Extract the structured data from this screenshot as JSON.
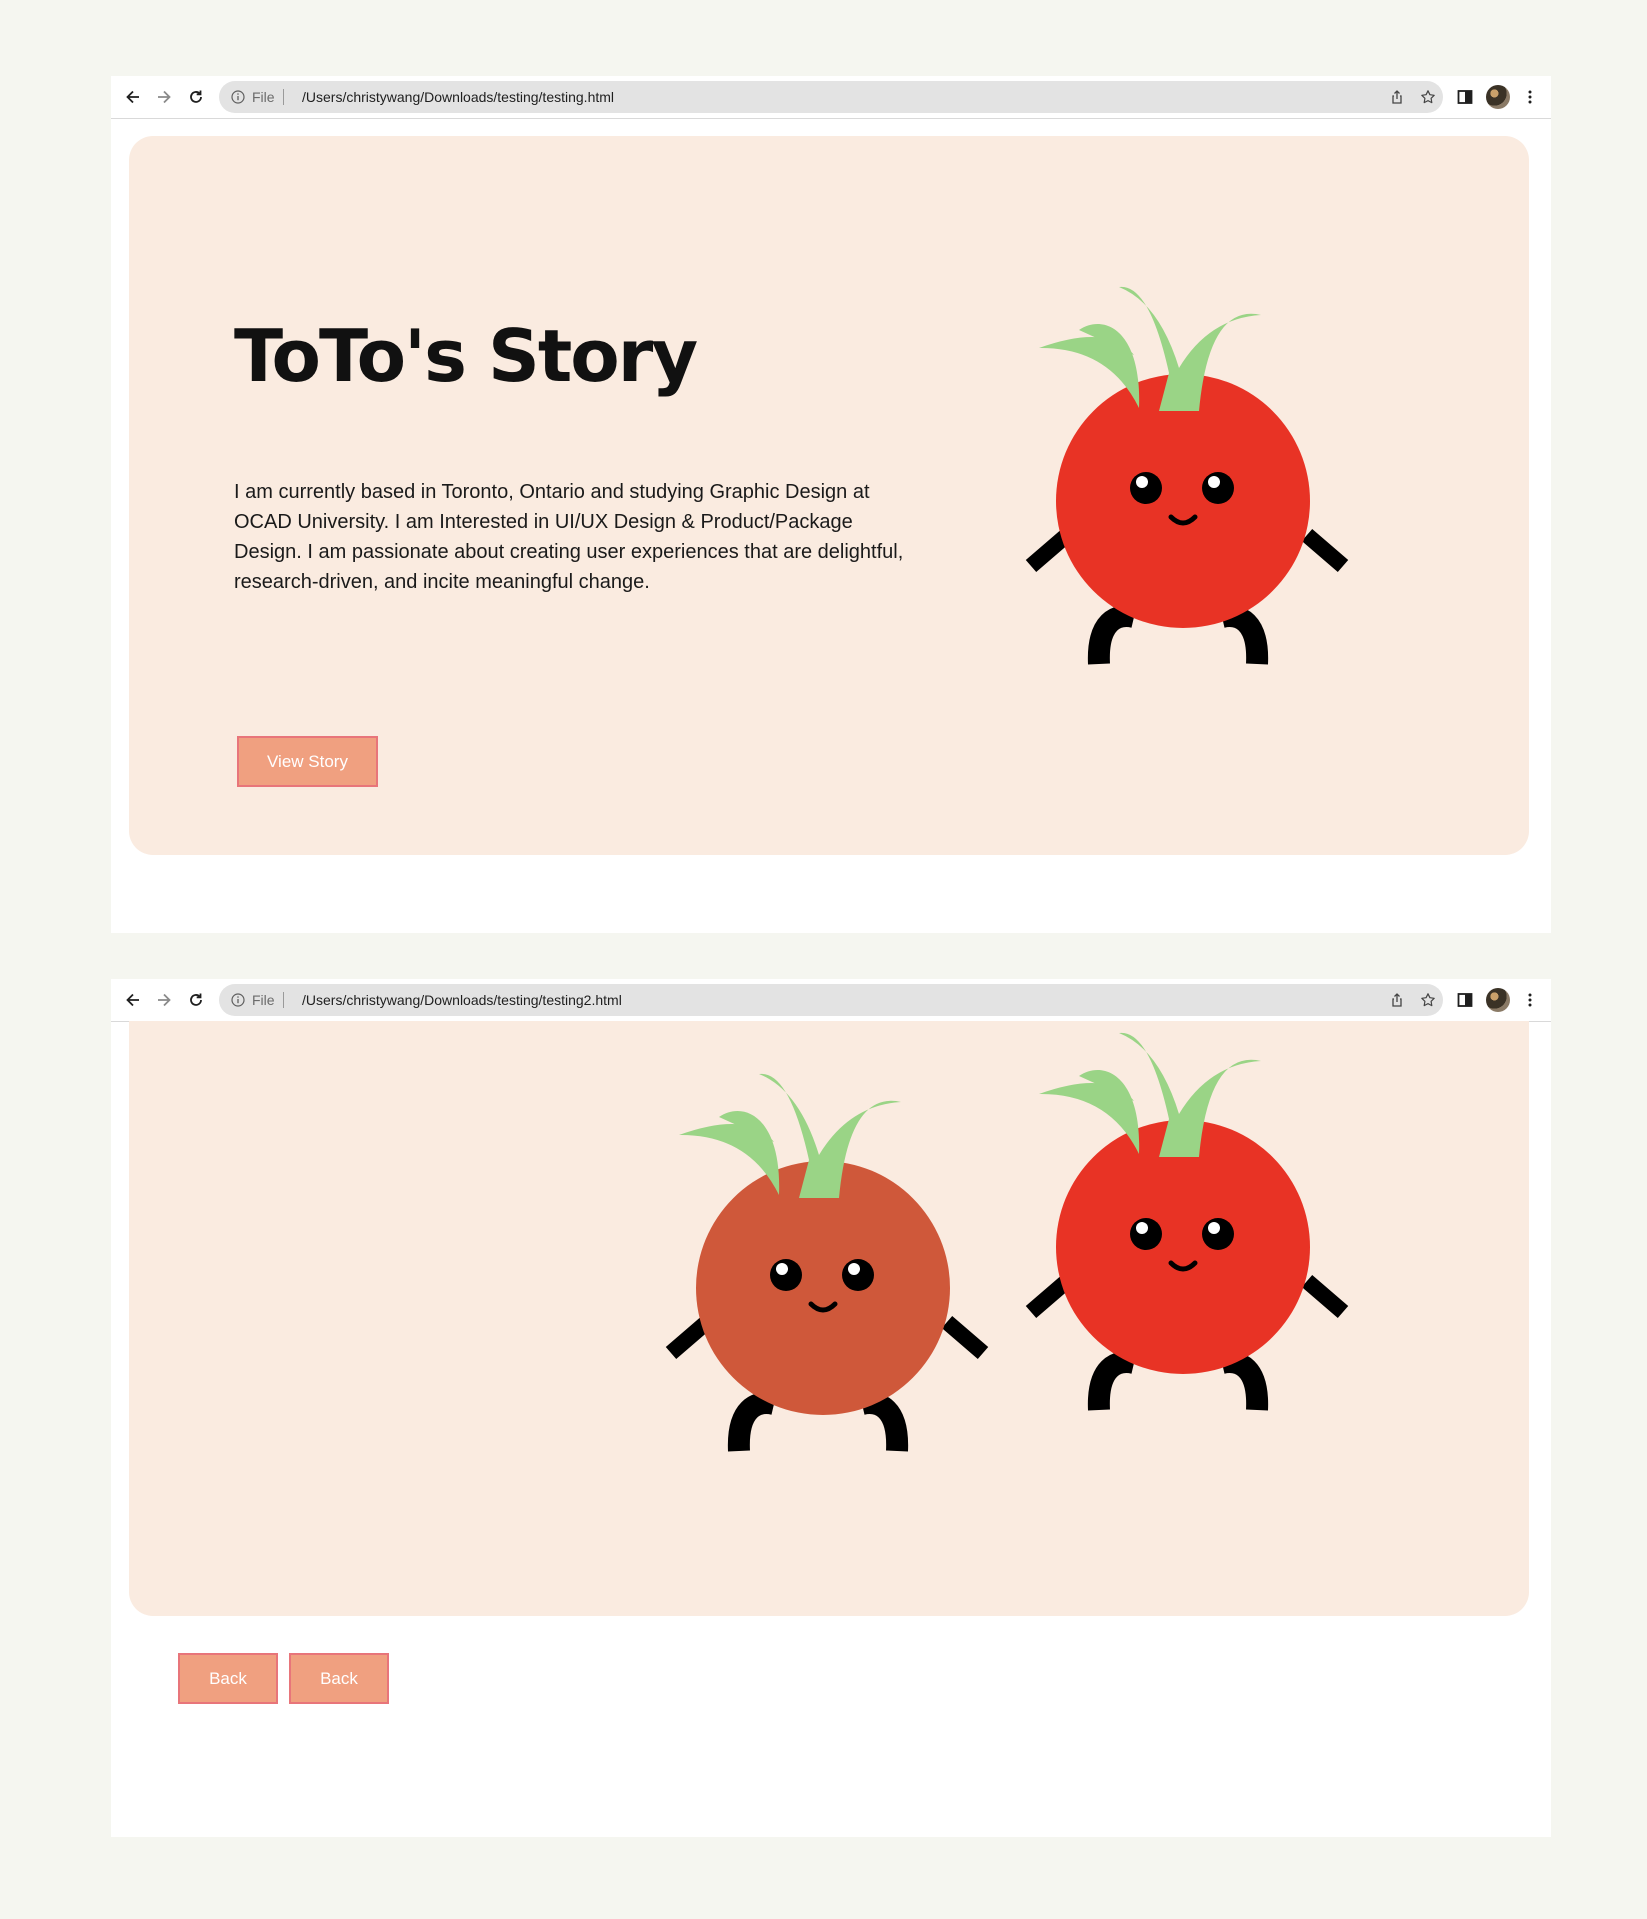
{
  "colors": {
    "page_background": "#f5f6f0",
    "hero_background": "#faebe0",
    "button_fill": "#f0a080",
    "button_border": "#e8757a",
    "tomato_red": "#e83325",
    "tomato_rust": "#cf583a",
    "leaf_green": "#9ad486"
  },
  "window1": {
    "omnibox": {
      "scheme_label": "File",
      "url": "/Users/christywang/Downloads/testing/testing.html"
    },
    "hero": {
      "title": "ToTo's Story",
      "description": "I am currently based in Toronto, Ontario and studying Graphic Design at OCAD University. I am Interested in UI/UX Design & Product/Package Design. I am passionate about creating user experiences that are delightful, research-driven, and incite meaningful change.",
      "button_label": "View Story"
    }
  },
  "window2": {
    "omnibox": {
      "scheme_label": "File",
      "url": "/Users/christywang/Downloads/testing/testing2.html"
    },
    "buttons": [
      "Back",
      "Back"
    ]
  },
  "icons": [
    "back-arrow-icon",
    "forward-arrow-icon",
    "reload-icon",
    "info-icon",
    "share-icon",
    "bookmark-star-icon",
    "side-panel-icon",
    "profile-avatar",
    "more-menu-icon"
  ]
}
